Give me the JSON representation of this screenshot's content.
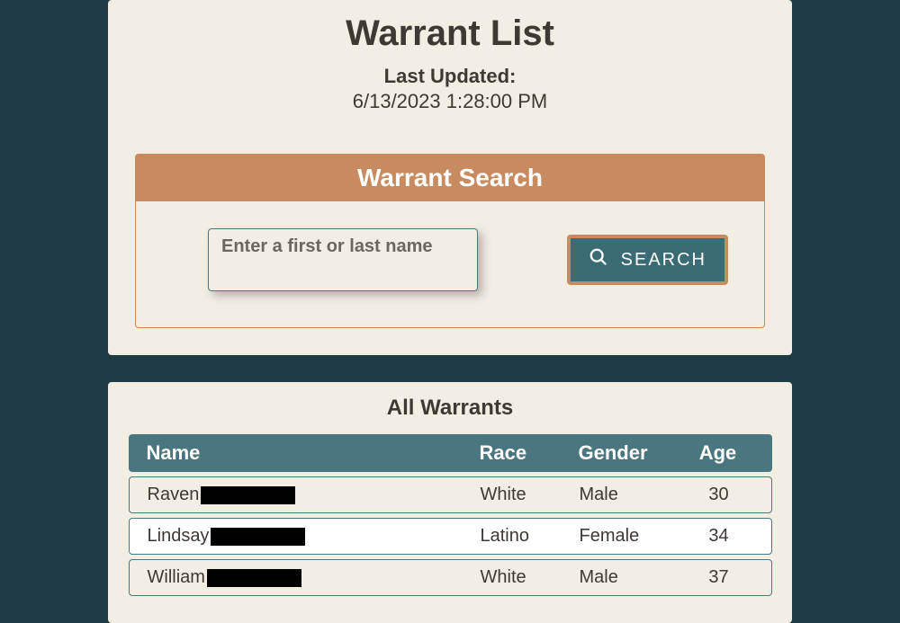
{
  "header": {
    "title": "Warrant List",
    "last_updated_label": "Last Updated:",
    "last_updated_value": "6/13/2023 1:28:00 PM"
  },
  "search": {
    "title": "Warrant Search",
    "placeholder": "Enter a first or last name",
    "button_label": "SEARCH",
    "value": ""
  },
  "results": {
    "title": "All Warrants",
    "columns": {
      "name": "Name",
      "race": "Race",
      "gender": "Gender",
      "age": "Age"
    },
    "rows": [
      {
        "first_name": "Raven",
        "race": "White",
        "gender": "Male",
        "age": "30"
      },
      {
        "first_name": "Lindsay",
        "race": "Latino",
        "gender": "Female",
        "age": "34"
      },
      {
        "first_name": "William",
        "race": "White",
        "gender": "Male",
        "age": "37"
      }
    ]
  }
}
